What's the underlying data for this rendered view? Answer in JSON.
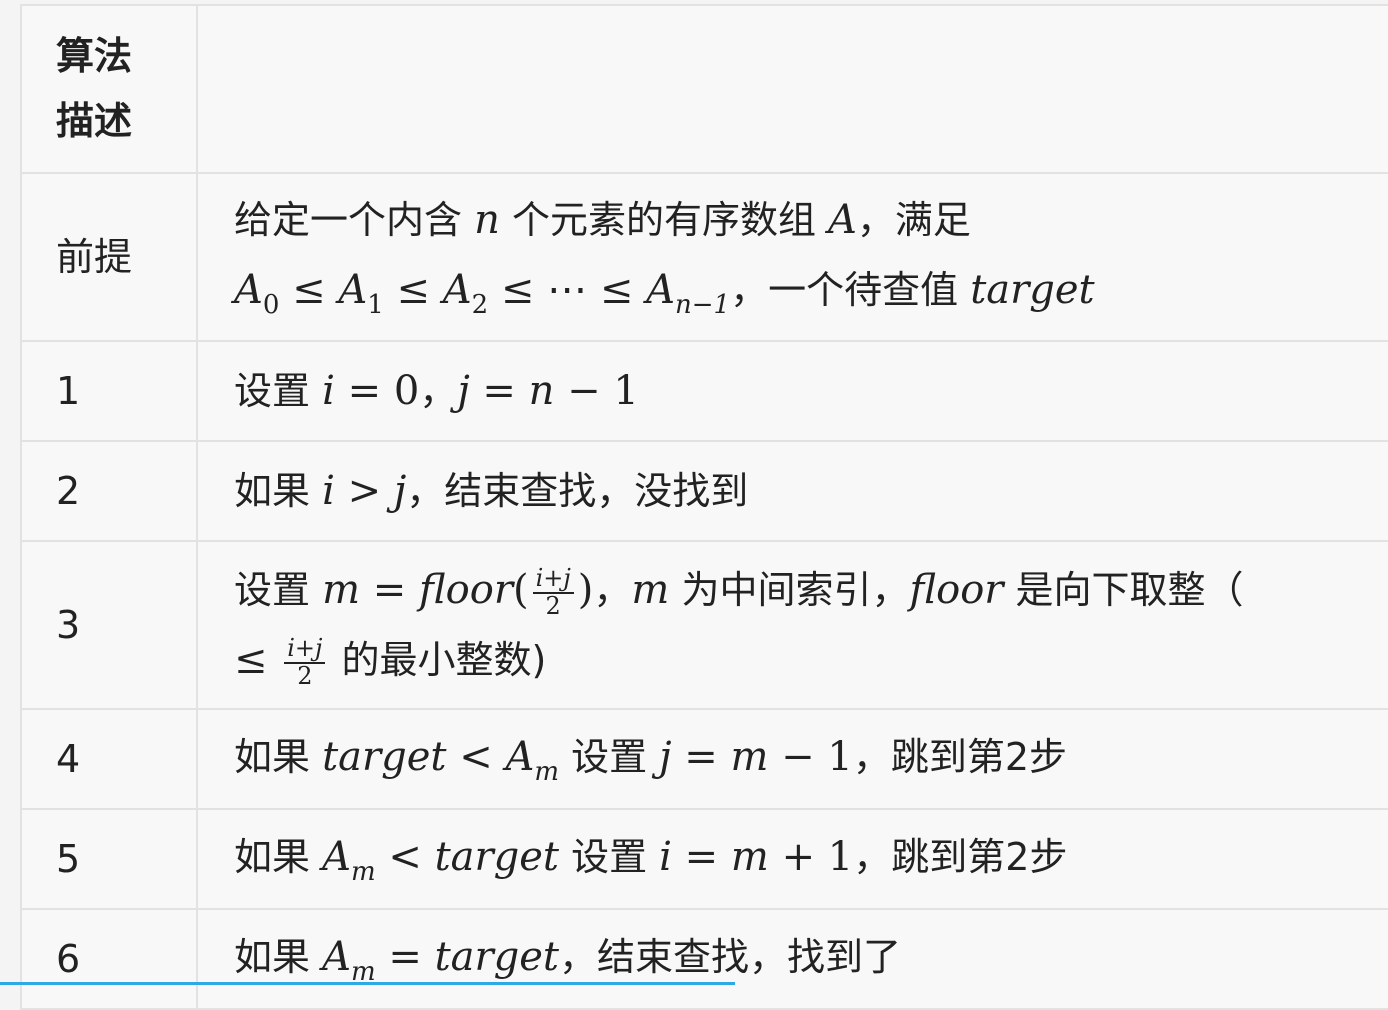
{
  "header": {
    "col1_line1": "算法",
    "col1_line2": "描述",
    "col2": ""
  },
  "rows": [
    {
      "label": "前提",
      "line1": [
        "给定一个内含 ",
        "n",
        " 个元素的有序数组 ",
        "A",
        "，满足"
      ],
      "line2": {
        "a": "A",
        "s0": "0",
        "le": " ≤ ",
        "s1": "1",
        "s2": "2",
        "dots": "⋯",
        "sn": "n−1",
        "text": "，一个待查值 ",
        "target": "target"
      }
    },
    {
      "label": "1",
      "parts": [
        "设置 ",
        "i",
        " = 0",
        "，",
        "j",
        " = ",
        "n",
        " − 1"
      ]
    },
    {
      "label": "2",
      "parts": [
        "如果 ",
        "i",
        " > ",
        "j",
        "，结束查找，没找到"
      ]
    },
    {
      "label": "3",
      "line1": {
        "t1": "设置 ",
        "m": "m",
        "eq": " = ",
        "floor": "floor",
        "lp": "(",
        "num": "i+j",
        "den": "2",
        "rp": ")",
        "t2": "，",
        "m2": "m",
        "t3": " 为中间索引，",
        "floor2": "floor",
        "t4": " 是向下取整（"
      },
      "line2": {
        "le": "≤ ",
        "num": "i+j",
        "den": "2",
        "t": " 的最小整数)"
      }
    },
    {
      "label": "4",
      "parts": [
        "如果 ",
        "target",
        " < ",
        "A",
        "m",
        " 设置 ",
        "j",
        " = ",
        "m",
        " − 1",
        "，跳到第2步"
      ]
    },
    {
      "label": "5",
      "parts": [
        "如果 ",
        "A",
        "m",
        " < ",
        "target",
        " 设置 ",
        "i",
        " = ",
        "m",
        " + 1",
        "，跳到第2步"
      ]
    },
    {
      "label": "6",
      "parts": [
        "如果 ",
        "A",
        "m",
        " = ",
        "target",
        "，结束查找，找到了"
      ]
    }
  ],
  "colors": {
    "accent_line": "#2fa8e6",
    "border": "#e2e2e2",
    "background": "#f8f8f8"
  }
}
